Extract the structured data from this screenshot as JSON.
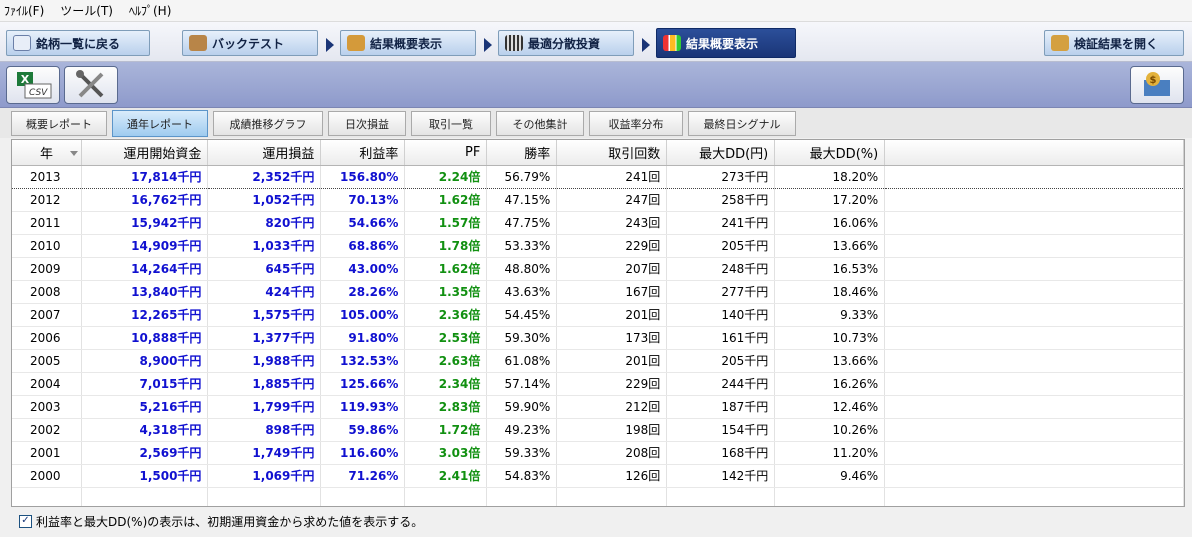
{
  "menu": [
    "ﾌｧｲﾙ(F)",
    "ツール(T)",
    "ﾍﾙﾌﾟ(H)"
  ],
  "nav": {
    "back": "銘柄一覧に戻る",
    "backtest": "バックテスト",
    "summary1": "結果概要表示",
    "optimal": "最適分散投資",
    "summary2": "結果概要表示",
    "verify": "検証結果を開く"
  },
  "toolbar": {
    "csv_label": "CSV"
  },
  "tabs": [
    "概要レポート",
    "通年レポート",
    "成績推移グラフ",
    "日次損益",
    "取引一覧",
    "その他集計",
    "収益率分布",
    "最終日シグナル"
  ],
  "active_tab": "通年レポート",
  "table": {
    "columns": [
      "年",
      "運用開始資金",
      "運用損益",
      "利益率",
      "PF",
      "勝率",
      "取引回数",
      "最大DD(円)",
      "最大DD(%)"
    ],
    "rows": [
      [
        "2013",
        "17,814千円",
        "2,352千円",
        "156.80%",
        "2.24倍",
        "56.79%",
        "241回",
        "273千円",
        "18.20%"
      ],
      [
        "2012",
        "16,762千円",
        "1,052千円",
        "70.13%",
        "1.62倍",
        "47.15%",
        "247回",
        "258千円",
        "17.20%"
      ],
      [
        "2011",
        "15,942千円",
        "820千円",
        "54.66%",
        "1.57倍",
        "47.75%",
        "243回",
        "241千円",
        "16.06%"
      ],
      [
        "2010",
        "14,909千円",
        "1,033千円",
        "68.86%",
        "1.78倍",
        "53.33%",
        "229回",
        "205千円",
        "13.66%"
      ],
      [
        "2009",
        "14,264千円",
        "645千円",
        "43.00%",
        "1.62倍",
        "48.80%",
        "207回",
        "248千円",
        "16.53%"
      ],
      [
        "2008",
        "13,840千円",
        "424千円",
        "28.26%",
        "1.35倍",
        "43.63%",
        "167回",
        "277千円",
        "18.46%"
      ],
      [
        "2007",
        "12,265千円",
        "1,575千円",
        "105.00%",
        "2.36倍",
        "54.45%",
        "201回",
        "140千円",
        "9.33%"
      ],
      [
        "2006",
        "10,888千円",
        "1,377千円",
        "91.80%",
        "2.53倍",
        "59.30%",
        "173回",
        "161千円",
        "10.73%"
      ],
      [
        "2005",
        "8,900千円",
        "1,988千円",
        "132.53%",
        "2.63倍",
        "61.08%",
        "201回",
        "205千円",
        "13.66%"
      ],
      [
        "2004",
        "7,015千円",
        "1,885千円",
        "125.66%",
        "2.34倍",
        "57.14%",
        "229回",
        "244千円",
        "16.26%"
      ],
      [
        "2003",
        "5,216千円",
        "1,799千円",
        "119.93%",
        "2.83倍",
        "59.90%",
        "212回",
        "187千円",
        "12.46%"
      ],
      [
        "2002",
        "4,318千円",
        "898千円",
        "59.86%",
        "1.72倍",
        "49.23%",
        "198回",
        "154千円",
        "10.26%"
      ],
      [
        "2001",
        "2,569千円",
        "1,749千円",
        "116.60%",
        "3.03倍",
        "59.33%",
        "208回",
        "168千円",
        "11.20%"
      ],
      [
        "2000",
        "1,500千円",
        "1,069千円",
        "71.26%",
        "2.41倍",
        "54.83%",
        "126回",
        "142千円",
        "9.46%"
      ]
    ]
  },
  "footer": {
    "checkbox_label": "利益率と最大DD(%)の表示は、初期運用資金から求めた値を表示する。",
    "checked": true
  },
  "colors": {
    "accent_blue": "#1010d0",
    "accent_green": "#119011",
    "nav_active": "#1a3577",
    "toolbar_bg": "#9aa6d3"
  }
}
